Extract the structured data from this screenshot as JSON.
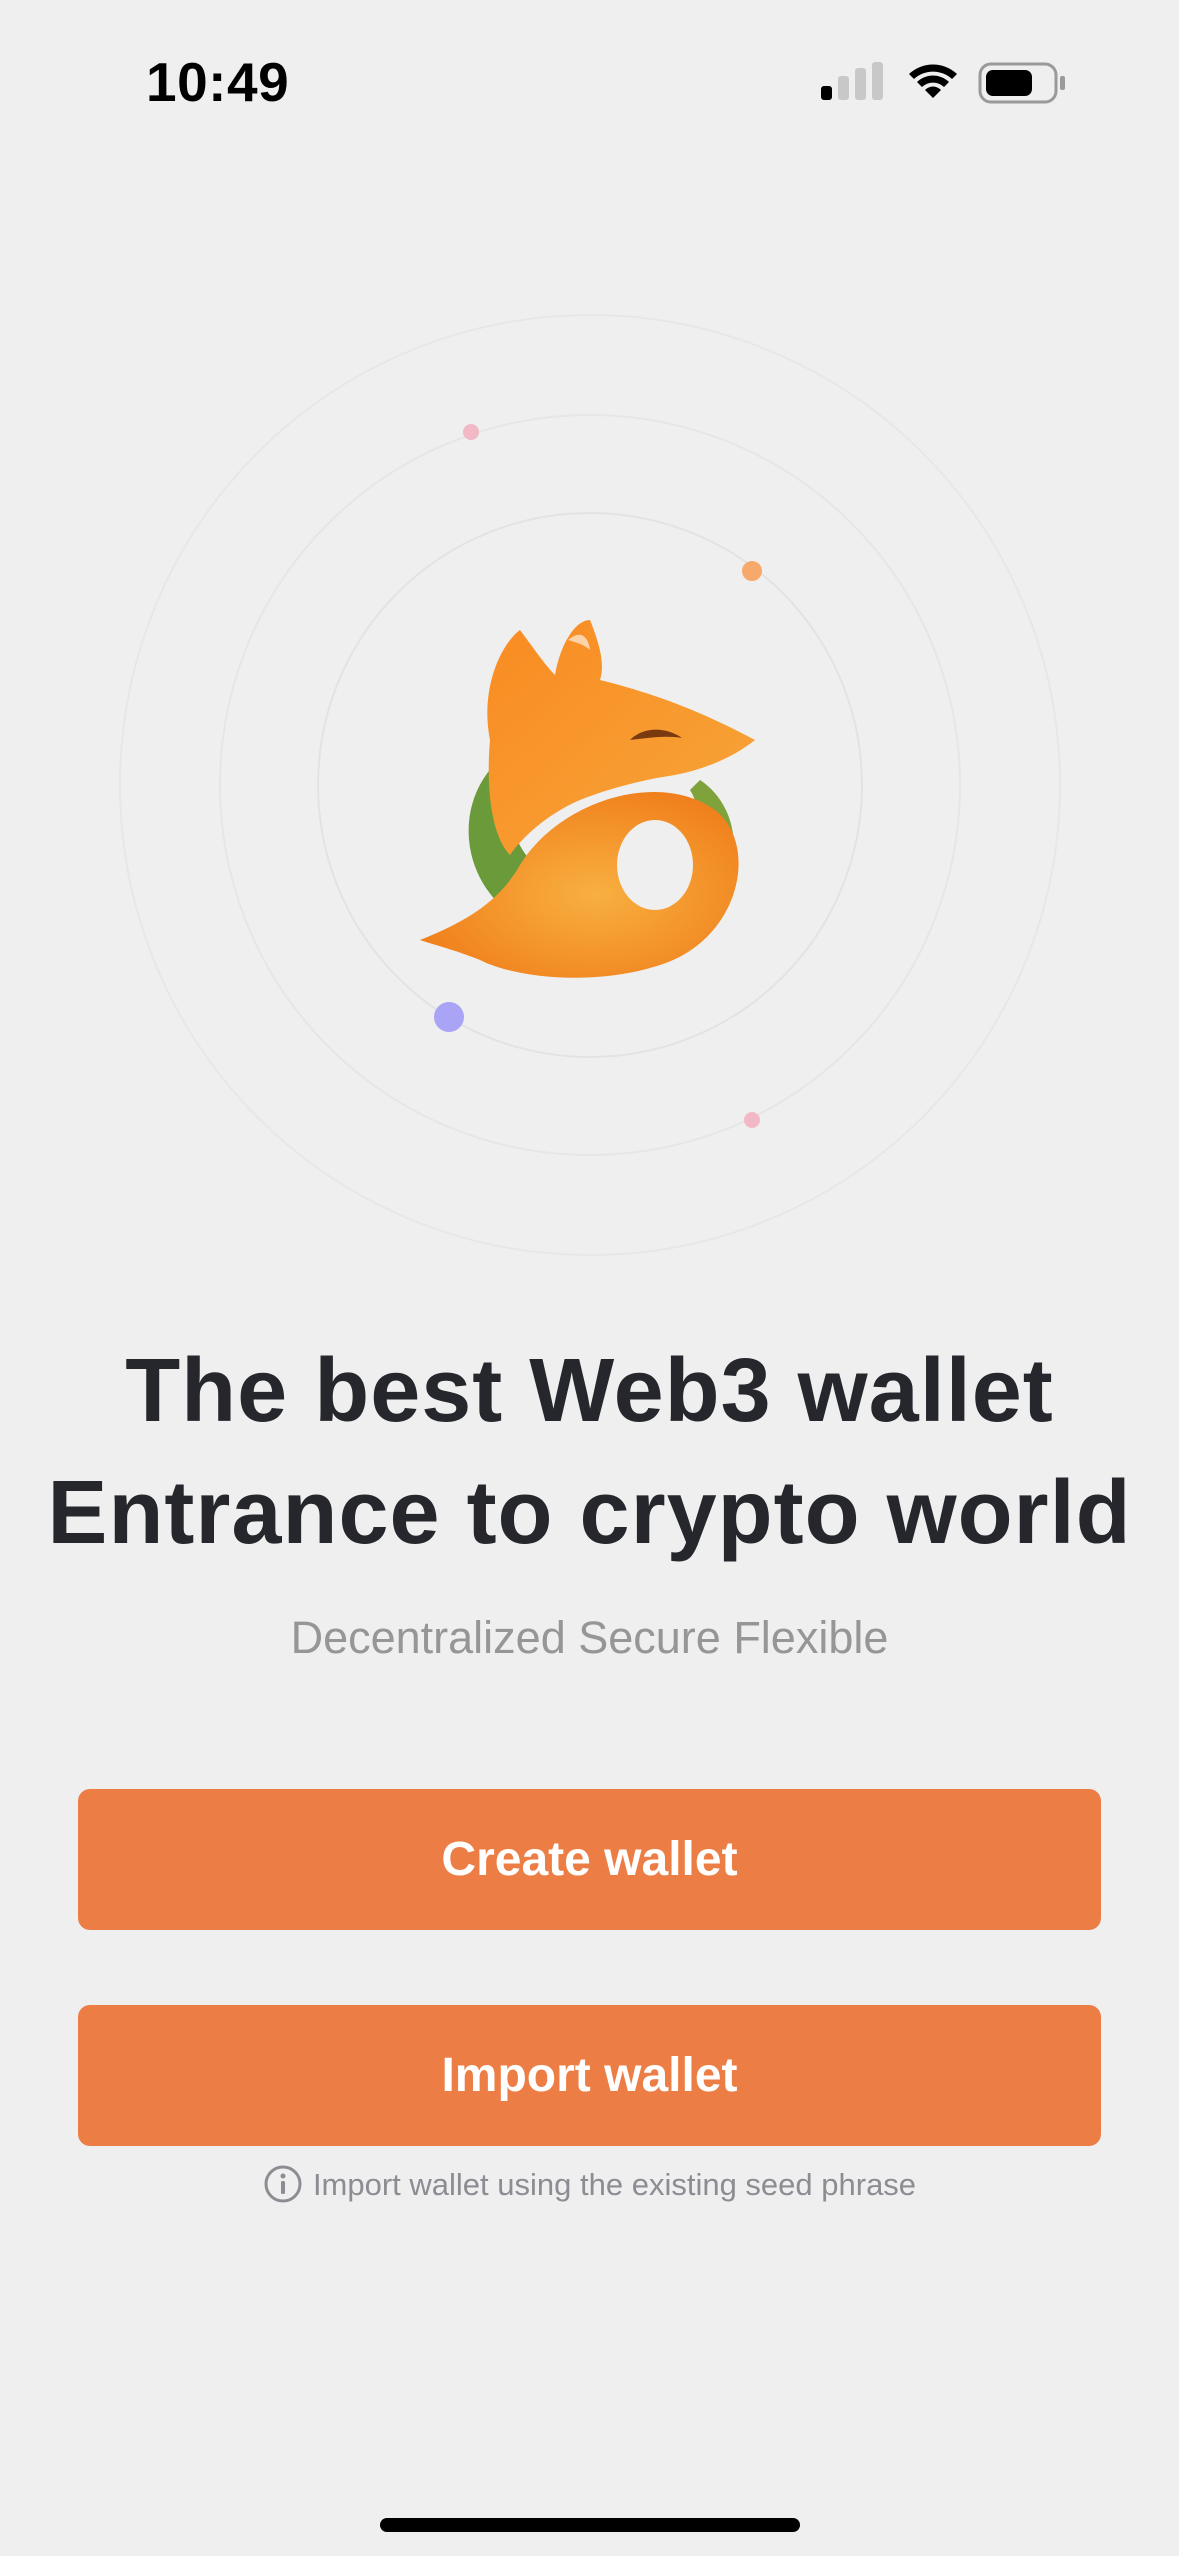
{
  "status_bar": {
    "time": "10:49",
    "icons": [
      "cellular-signal-icon",
      "wifi-icon",
      "battery-icon"
    ]
  },
  "hero": {
    "logo": "fox-logo",
    "colors": {
      "orange": "#f7931e",
      "green": "#6b9a3a",
      "dot_pink": "#f2b8c6",
      "dot_orange": "#f6a96b",
      "dot_purple": "#a9a4f5"
    }
  },
  "headline": {
    "line1": "The best Web3 wallet",
    "line2": "Entrance to crypto world"
  },
  "subtitle": "Decentralized Secure Flexible",
  "actions": {
    "create_label": "Create wallet",
    "import_label": "Import wallet",
    "import_hint": "Import wallet using the existing seed phrase"
  },
  "theme": {
    "accent": "#ec7e45",
    "background": "#efefef",
    "text_primary": "#25272c",
    "text_secondary": "#969696"
  }
}
